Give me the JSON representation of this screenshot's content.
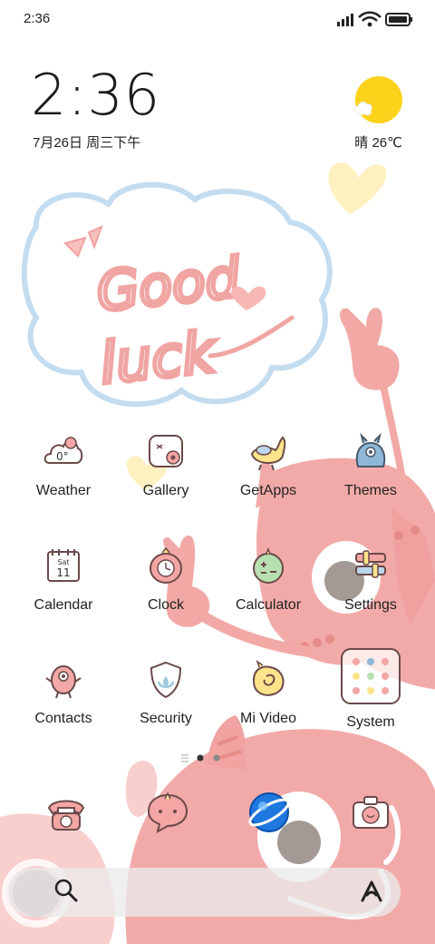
{
  "status_bar": {
    "time": "2:36"
  },
  "clock_widget": {
    "time": "2:36",
    "date": "7月26日 周三下午"
  },
  "weather_widget": {
    "condition": "晴",
    "temperature": "26℃",
    "text": "晴 26℃",
    "icon": "sun-cloud-icon"
  },
  "apps": [
    {
      "label": "Weather",
      "icon": "weather-cloud-icon",
      "temp": "0°"
    },
    {
      "label": "Gallery",
      "icon": "gallery-camera-icon"
    },
    {
      "label": "GetApps",
      "icon": "getapps-bird-icon"
    },
    {
      "label": "Themes",
      "icon": "themes-monster-icon"
    },
    {
      "label": "Calendar",
      "icon": "calendar-icon",
      "day_name": "Sat",
      "day_number": "11"
    },
    {
      "label": "Clock",
      "icon": "clock-monster-icon"
    },
    {
      "label": "Calculator",
      "icon": "calculator-icon"
    },
    {
      "label": "Settings",
      "icon": "settings-icon"
    },
    {
      "label": "Contacts",
      "icon": "contacts-monster-icon"
    },
    {
      "label": "Security",
      "icon": "security-shield-icon"
    },
    {
      "label": "Mi Video",
      "icon": "mi-video-icon"
    },
    {
      "label": "System",
      "icon": "system-folder-icon"
    }
  ],
  "dock": [
    {
      "icon": "phone-icon"
    },
    {
      "icon": "messages-icon"
    },
    {
      "icon": "browser-icon"
    },
    {
      "icon": "camera-icon"
    }
  ],
  "page_indicator": {
    "pages": 2,
    "active": 0
  },
  "colors": {
    "pink": "#f2a9a6",
    "pink_dark": "#e58b88",
    "blue_outline": "#bcd6ee",
    "yellow": "#fde38a",
    "sun": "#fdd21a"
  }
}
